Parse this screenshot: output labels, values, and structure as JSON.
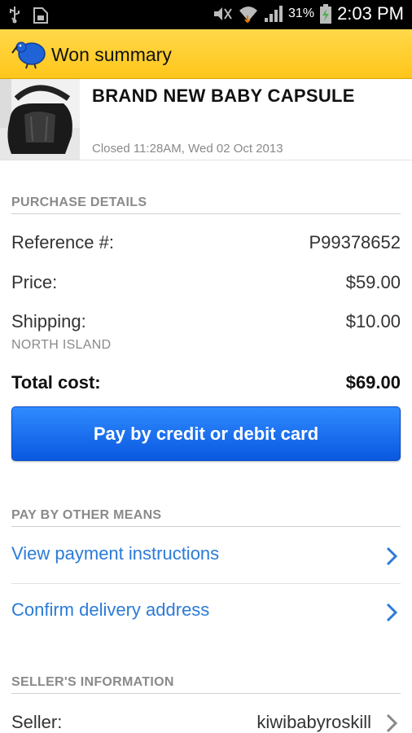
{
  "status_bar": {
    "battery_percent": "31%",
    "time": "2:03 PM"
  },
  "action_bar": {
    "title": "Won summary"
  },
  "listing": {
    "title": "BRAND NEW BABY CAPSULE",
    "closed": "Closed 11:28AM, Wed 02 Oct 2013"
  },
  "purchase": {
    "section_title": "PURCHASE DETAILS",
    "reference_label": "Reference #:",
    "reference_value": "P99378652",
    "price_label": "Price:",
    "price_value": "$59.00",
    "shipping_label": "Shipping:",
    "shipping_value": "$10.00",
    "shipping_region": "NORTH ISLAND",
    "total_label": "Total cost:",
    "total_value": "$69.00",
    "pay_button": "Pay by credit or debit card"
  },
  "other_means": {
    "section_title": "PAY BY OTHER MEANS",
    "links": [
      "View payment instructions",
      "Confirm delivery address"
    ]
  },
  "seller": {
    "section_title": "SELLER'S INFORMATION",
    "label": "Seller:",
    "value": "kiwibabyroskill"
  },
  "colors": {
    "action_bar": "#ffc61a",
    "link": "#2b7bd8",
    "button": "#0a58e0"
  }
}
